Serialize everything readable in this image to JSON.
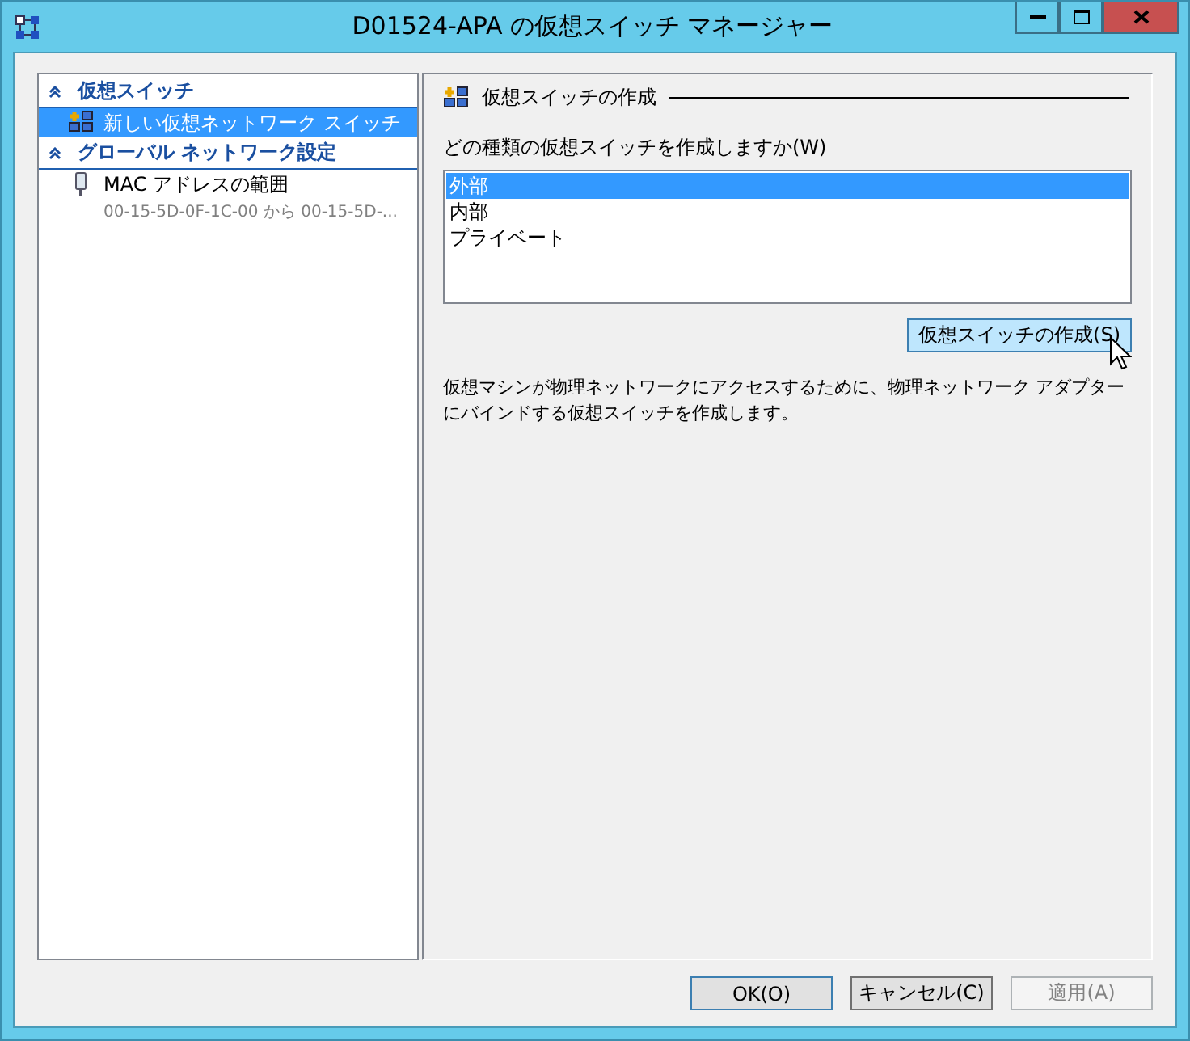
{
  "window": {
    "title": "D01524-APA の仮想スイッチ マネージャー"
  },
  "sidebar": {
    "sections": [
      {
        "title": "仮想スイッチ",
        "expanded": true,
        "items": [
          {
            "kind": "switch",
            "label": "新しい仮想ネットワーク スイッチ",
            "selected": true
          }
        ]
      },
      {
        "title": "グローバル ネットワーク設定",
        "expanded": true,
        "items": [
          {
            "kind": "mac",
            "label": "MAC アドレスの範囲",
            "detail": "00-15-5D-0F-1C-00 から 00-15-5D-...",
            "selected": false
          }
        ]
      }
    ]
  },
  "panel": {
    "heading": "仮想スイッチの作成",
    "prompt": "どの種類の仮想スイッチを作成しますか(W)",
    "options": [
      {
        "label": "外部",
        "selected": true
      },
      {
        "label": "内部",
        "selected": false
      },
      {
        "label": "プライベート",
        "selected": false
      }
    ],
    "create_button": "仮想スイッチの作成(S)",
    "description": "仮想マシンが物理ネットワークにアクセスするために、物理ネットワーク アダプターにバインドする仮想スイッチを作成します。"
  },
  "buttons": [
    {
      "label": "OK(O)",
      "default": true,
      "disabled": false
    },
    {
      "label": "キャンセル(C)",
      "default": false,
      "disabled": false
    },
    {
      "label": "適用(A)",
      "default": false,
      "disabled": true
    }
  ]
}
